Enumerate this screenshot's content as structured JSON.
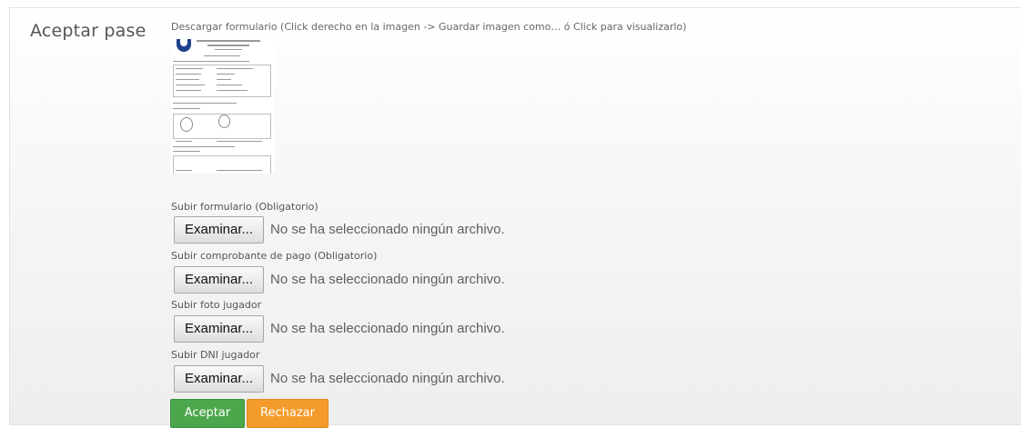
{
  "title": "Aceptar pase",
  "download": {
    "text": "Descargar formulario (Click derecho en la imagen -> Guardar imagen como… ó Click para visualizarlo)"
  },
  "uploads": [
    {
      "label": "Subir formulario (Obligatorio)",
      "button": "Examinar...",
      "status": "No se ha seleccionado ningún archivo."
    },
    {
      "label": "Subir comprobante de pago (Obligatorio)",
      "button": "Examinar...",
      "status": "No se ha seleccionado ningún archivo."
    },
    {
      "label": "Subir foto jugador",
      "button": "Examinar...",
      "status": "No se ha seleccionado ningún archivo."
    },
    {
      "label": "Subir DNI jugador",
      "button": "Examinar...",
      "status": "No se ha seleccionado ningún archivo."
    }
  ],
  "actions": {
    "accept": "Aceptar",
    "reject": "Rechazar"
  },
  "colors": {
    "accept": "#4ca74c",
    "reject": "#f39c2c",
    "logo": "#1d3f8c"
  }
}
